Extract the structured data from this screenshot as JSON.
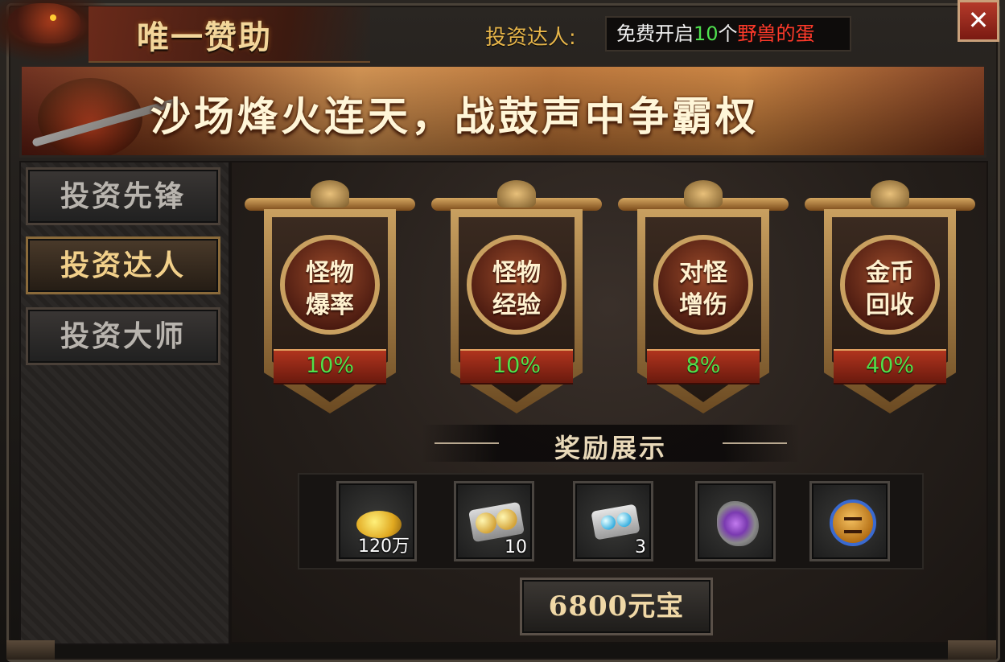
{
  "window": {
    "title": "唯一赞助",
    "close_label": "✕"
  },
  "promo": {
    "label": "投资达人:",
    "text_prefix": "免费开启",
    "count": "10",
    "text_mid": "个",
    "item_name": "野兽的蛋"
  },
  "banner": {
    "slogan": "沙场烽火连天，战鼓声中争霸权"
  },
  "sidebar": {
    "items": [
      {
        "label": "投资先锋",
        "active": false
      },
      {
        "label": "投资达人",
        "active": true
      },
      {
        "label": "投资大师",
        "active": false
      }
    ]
  },
  "bonuses": [
    {
      "title": "怪物\n爆率",
      "value": "10%"
    },
    {
      "title": "怪物\n经验",
      "value": "10%"
    },
    {
      "title": "对怪\n增伤",
      "value": "8%"
    },
    {
      "title": "金币\n回收",
      "value": "40%"
    }
  ],
  "rewards": {
    "title": "奖励展示",
    "items": [
      {
        "icon": "gold-coins-icon",
        "qty": "120万"
      },
      {
        "icon": "beast-eggs-icon",
        "qty": "10"
      },
      {
        "icon": "blue-pearls-icon",
        "qty": "3"
      },
      {
        "icon": "purple-stone-icon",
        "qty": ""
      },
      {
        "icon": "medallion-icon",
        "qty": ""
      }
    ]
  },
  "purchase": {
    "label": "6800元宝"
  },
  "colors": {
    "value_green": "#52e04a",
    "highlight_red": "#ff3a2a",
    "gold_text": "#f2d08a"
  }
}
